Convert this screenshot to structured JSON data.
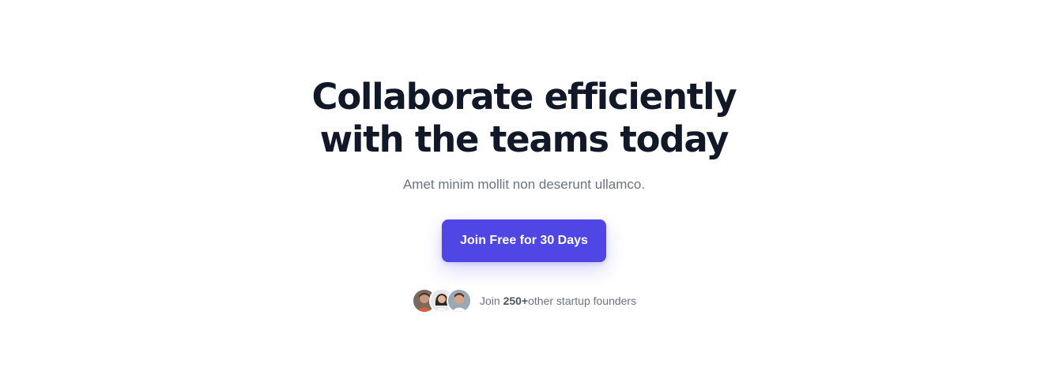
{
  "hero": {
    "headline_line1": "Collaborate efficiently",
    "headline_line2": "with the teams today",
    "subtitle": "Amet minim mollit non deserunt ullamco.",
    "cta_label": "Join Free for 30 Days"
  },
  "social_proof": {
    "prefix": "Join ",
    "count": "250+",
    "suffix": "other startup founders",
    "avatars": [
      "founder-avatar-1",
      "founder-avatar-2",
      "founder-avatar-3"
    ]
  },
  "colors": {
    "accent": "#4f46e5",
    "heading": "#111827",
    "muted": "#6b7280"
  }
}
